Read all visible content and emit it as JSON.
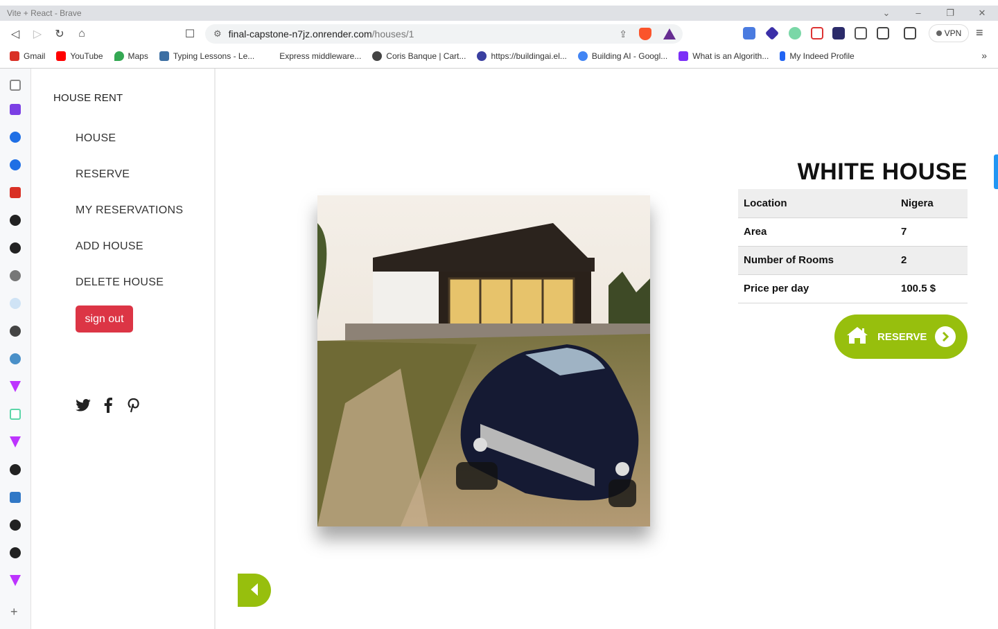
{
  "browser": {
    "window_title": "Vite + React - Brave",
    "url_host": "final-capstone-n7jz.onrender.com",
    "url_path": "/houses/1",
    "vpn_label": "VPN",
    "bookmarks": [
      {
        "label": "Gmail",
        "icon": "gmail-icon",
        "color": "#d93025"
      },
      {
        "label": "YouTube",
        "icon": "youtube-icon",
        "color": "#ff0000"
      },
      {
        "label": "Maps",
        "icon": "maps-icon",
        "color": "#34a853"
      },
      {
        "label": "Typing Lessons - Le...",
        "icon": "typing-icon",
        "color": "#3d6fa3"
      },
      {
        "label": "Express middleware...",
        "icon": "blank-icon",
        "color": "#ffffff"
      },
      {
        "label": "Coris Banque | Cart...",
        "icon": "globe-icon",
        "color": "#444444"
      },
      {
        "label": "https://buildingai.el...",
        "icon": "buildingai-icon",
        "color": "#3a3fa0"
      },
      {
        "label": "Building AI - Googl...",
        "icon": "google-icon",
        "color": "#4285f4"
      },
      {
        "label": "What is an Algorith...",
        "icon": "algorithm-icon",
        "color": "#7b2ff7"
      },
      {
        "label": "My Indeed Profile",
        "icon": "indeed-icon",
        "color": "#2164f3"
      }
    ]
  },
  "sidebar": {
    "brand": "HOUSE RENT",
    "nav": [
      {
        "label": "HOUSE"
      },
      {
        "label": "RESERVE"
      },
      {
        "label": "MY RESERVATIONS"
      },
      {
        "label": "ADD HOUSE"
      },
      {
        "label": "DELETE HOUSE"
      }
    ],
    "signout_label": "sign out"
  },
  "house": {
    "name": "WHITE HOUSE",
    "details": [
      {
        "label": "Location",
        "value": "Nigera"
      },
      {
        "label": "Area",
        "value": "7"
      },
      {
        "label": "Number of Rooms",
        "value": "2"
      },
      {
        "label": "Price per day",
        "value": "100.5 $"
      }
    ],
    "reserve_label": "RESERVE"
  },
  "colors": {
    "accent": "#97bf0d",
    "danger": "#dc3545"
  }
}
